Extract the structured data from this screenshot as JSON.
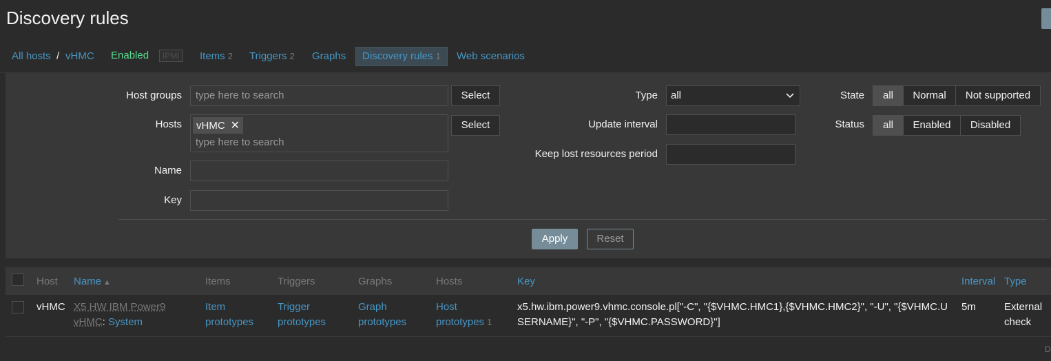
{
  "header": {
    "title": "Discovery rules"
  },
  "nav": {
    "all_hosts": "All hosts",
    "separator": "/",
    "host": "vHMC",
    "status": "Enabled",
    "ipmi": "IPMI",
    "items_label": "Items",
    "items_count": "2",
    "triggers_label": "Triggers",
    "triggers_count": "2",
    "graphs_label": "Graphs",
    "discovery_label": "Discovery rules",
    "discovery_count": "1",
    "web_label": "Web scenarios"
  },
  "filter": {
    "host_groups_label": "Host groups",
    "host_groups_placeholder": "type here to search",
    "select_label": "Select",
    "hosts_label": "Hosts",
    "hosts_chip": "vHMC",
    "hosts_chip_remove": "✕",
    "hosts_placeholder": "type here to search",
    "name_label": "Name",
    "key_label": "Key",
    "type_label": "Type",
    "type_value": "all",
    "update_interval_label": "Update interval",
    "keep_lost_label": "Keep lost resources period",
    "state_label": "State",
    "state_options": [
      "all",
      "Normal",
      "Not supported"
    ],
    "status_label": "Status",
    "status_options": [
      "all",
      "Enabled",
      "Disabled"
    ],
    "apply_label": "Apply",
    "reset_label": "Reset"
  },
  "table": {
    "headers": {
      "host": "Host",
      "name": "Name",
      "name_sort": "▲",
      "items": "Items",
      "triggers": "Triggers",
      "graphs": "Graphs",
      "hosts": "Hosts",
      "key": "Key",
      "interval": "Interval",
      "type": "Type"
    },
    "rows": [
      {
        "host": "vHMC",
        "template_line1": "X5 HW IBM Power9",
        "template_line2": "vHMC",
        "name_sep": ":",
        "name": "System",
        "items_l1": "Item",
        "items_l2": "prototypes",
        "triggers_l1": "Trigger",
        "triggers_l2": "prototypes",
        "graphs_l1": "Graph",
        "graphs_l2": "prototypes",
        "hosts_l1": "Host",
        "hosts_l2": "prototypes",
        "hosts_count": "1",
        "key_l1": "x5.hw.ibm.power9.vhmc.console.pl[\"-C\", \"{$VHMC.HMC1},{$VHMC.HMC2}\", \"-U\", \"{$VHMC.U",
        "key_l2": "SERNAME}\", \"-P\", \"{$VHMC.PASSWORD}\"]",
        "interval": "5m",
        "type_l1": "External",
        "type_l2": "check"
      }
    ],
    "tail": "D"
  },
  "colors": {
    "accent_link": "#4796c4",
    "enabled_green": "#59db8f",
    "button_primary": "#768d99",
    "background": "#2b2b2b",
    "panel": "#383838"
  }
}
